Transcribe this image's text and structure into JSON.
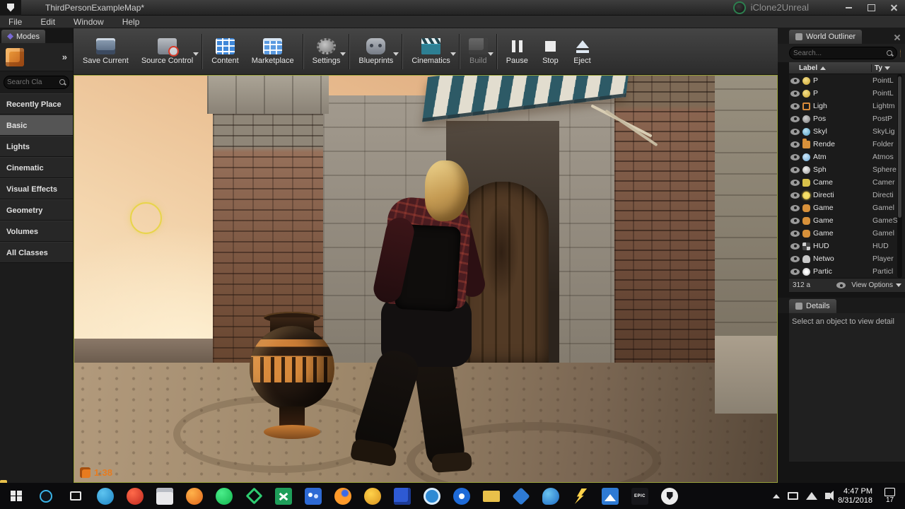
{
  "colors": {
    "viewport_highlight": "#97a03a",
    "timer_orange": "#e87b1e",
    "selection_circle_yellow": "#e8d44a",
    "selected_mode_bg": "#555555"
  },
  "window": {
    "title": "ThirdPersonExampleMap*",
    "brand": "iClone2Unreal"
  },
  "menu": {
    "items": [
      "File",
      "Edit",
      "Window",
      "Help"
    ]
  },
  "toolbar": {
    "buttons": [
      {
        "label": "Save Current"
      },
      {
        "label": "Source Control"
      },
      {
        "label": "Content"
      },
      {
        "label": "Marketplace"
      },
      {
        "label": "Settings"
      },
      {
        "label": "Blueprints"
      },
      {
        "label": "Cinematics"
      },
      {
        "label": "Build"
      },
      {
        "label": "Pause"
      },
      {
        "label": "Stop"
      },
      {
        "label": "Eject"
      }
    ]
  },
  "modes": {
    "tab": "Modes",
    "expand_glyph": "»",
    "search_placeholder": "Search Cla",
    "selected": "Basic",
    "items": [
      "Recently Place",
      "Basic",
      "Lights",
      "Cinematic",
      "Visual Effects",
      "Geometry",
      "Volumes",
      "All Classes"
    ]
  },
  "viewport": {
    "timer": "1:38"
  },
  "outliner": {
    "tab": "World Outliner",
    "search_placeholder": "Search...",
    "columns": {
      "label": "Label",
      "type": "Ty"
    },
    "rows": [
      {
        "label": "P",
        "type": "PointL",
        "icon": "pointlight"
      },
      {
        "label": "P",
        "type": "PointL",
        "icon": "pointlight"
      },
      {
        "label": "Ligh",
        "type": "Lightm",
        "icon": "lightmass-volume"
      },
      {
        "label": "Pos",
        "type": "PostP",
        "icon": "postprocess"
      },
      {
        "label": "Skyl",
        "type": "SkyLig",
        "icon": "skylight"
      },
      {
        "label": "Rende",
        "type": "Folder",
        "icon": "folder"
      },
      {
        "label": "Atm",
        "type": "Atmos",
        "icon": "atmosphere"
      },
      {
        "label": "Sph",
        "type": "Sphere",
        "icon": "sphere"
      },
      {
        "label": "Came",
        "type": "Camer",
        "icon": "camera"
      },
      {
        "label": "Directi",
        "type": "Directi",
        "icon": "directional-light"
      },
      {
        "label": "Game",
        "type": "Gamel",
        "icon": "game-mode"
      },
      {
        "label": "Game",
        "type": "GameS",
        "icon": "game-mode"
      },
      {
        "label": "Game",
        "type": "Gamel",
        "icon": "game-mode"
      },
      {
        "label": "HUD",
        "type": "HUD",
        "icon": "hud"
      },
      {
        "label": "Netwo",
        "type": "Player",
        "icon": "player-controller"
      },
      {
        "label": "Partic",
        "type": "Particl",
        "icon": "particle"
      }
    ],
    "footer_count": "312 a",
    "view_options": "View Options"
  },
  "details": {
    "tab": "Details",
    "empty_text": "Select an object to view detail"
  },
  "taskbar": {
    "time": "4:47 PM",
    "date": "8/31/2018",
    "notification_count": "17",
    "epic_label": "EPIC",
    "icons": [
      "windows-start",
      "cortana-search",
      "task-view",
      "app-blue-round",
      "app-red-round",
      "calculator",
      "app-orange-round",
      "app-green-round",
      "diagram-green",
      "excel",
      "people-blue",
      "browser-orange",
      "app-gold-round",
      "app-blue-square",
      "camera-blue",
      "app-blue-dot",
      "folder-yellow",
      "dropbox",
      "edge",
      "lightning",
      "photos",
      "epic-games-launcher",
      "unreal-engine"
    ]
  }
}
